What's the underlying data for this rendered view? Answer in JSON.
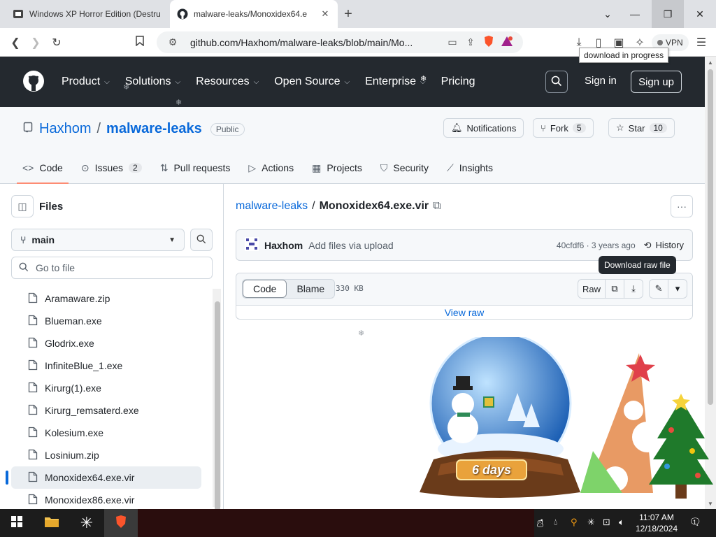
{
  "browser": {
    "tabs": [
      {
        "title": "Windows XP Horror Edition (Destru",
        "favicon": "video-icon",
        "active": false
      },
      {
        "title": "malware-leaks/Monoxidex64.e",
        "favicon": "github-icon",
        "active": true
      }
    ],
    "address": "github.com/Haxhom/malware-leaks/blob/main/Mo...",
    "vpn_label": "VPN",
    "download_tooltip": "download in progress"
  },
  "github": {
    "nav": [
      "Product",
      "Solutions",
      "Resources",
      "Open Source",
      "Enterprise",
      "Pricing"
    ],
    "sign_in": "Sign in",
    "sign_up": "Sign up"
  },
  "repo": {
    "owner": "Haxhom",
    "separator": "/",
    "name": "malware-leaks",
    "visibility": "Public",
    "notifications_label": "Notifications",
    "fork_label": "Fork",
    "fork_count": "5",
    "star_label": "Star",
    "star_count": "10",
    "tabs": [
      {
        "label": "Code",
        "icon": "code-icon",
        "count": ""
      },
      {
        "label": "Issues",
        "icon": "issue-icon",
        "count": "2"
      },
      {
        "label": "Pull requests",
        "icon": "pull-request-icon",
        "count": ""
      },
      {
        "label": "Actions",
        "icon": "play-icon",
        "count": ""
      },
      {
        "label": "Projects",
        "icon": "table-icon",
        "count": ""
      },
      {
        "label": "Security",
        "icon": "shield-icon",
        "count": ""
      },
      {
        "label": "Insights",
        "icon": "graph-icon",
        "count": ""
      }
    ]
  },
  "sidebar": {
    "title": "Files",
    "branch": "main",
    "goto_placeholder": "Go to file",
    "files": [
      {
        "name": "Aramaware.zip",
        "selected": false
      },
      {
        "name": "Blueman.exe",
        "selected": false
      },
      {
        "name": "Glodrix.exe",
        "selected": false
      },
      {
        "name": "InfiniteBlue_1.exe",
        "selected": false
      },
      {
        "name": "Kirurg(1).exe",
        "selected": false
      },
      {
        "name": "Kirurg_remsaterd.exe",
        "selected": false
      },
      {
        "name": "Kolesium.exe",
        "selected": false
      },
      {
        "name": "Losinium.zip",
        "selected": false
      },
      {
        "name": "Monoxidex64.exe.vir",
        "selected": true
      },
      {
        "name": "Monoxidex86.exe.vir",
        "selected": false
      }
    ]
  },
  "file": {
    "repo_crumb": "malware-leaks",
    "sep": "/",
    "name": "Monoxidex64.exe.vir",
    "commit": {
      "author": "Haxhom",
      "message": "Add files via upload",
      "sha_age": "40cfdf6 · 3 years ago",
      "history": "History"
    },
    "raw_tooltip": "Download raw file",
    "view_modes": [
      "Code",
      "Blame"
    ],
    "size": "330 KB",
    "raw_label": "Raw",
    "view_raw": "View raw"
  },
  "desktop": {
    "globe_label": "6 days"
  },
  "taskbar": {
    "time": "11:07 AM",
    "date": "12/18/2024",
    "notifications": "1"
  }
}
